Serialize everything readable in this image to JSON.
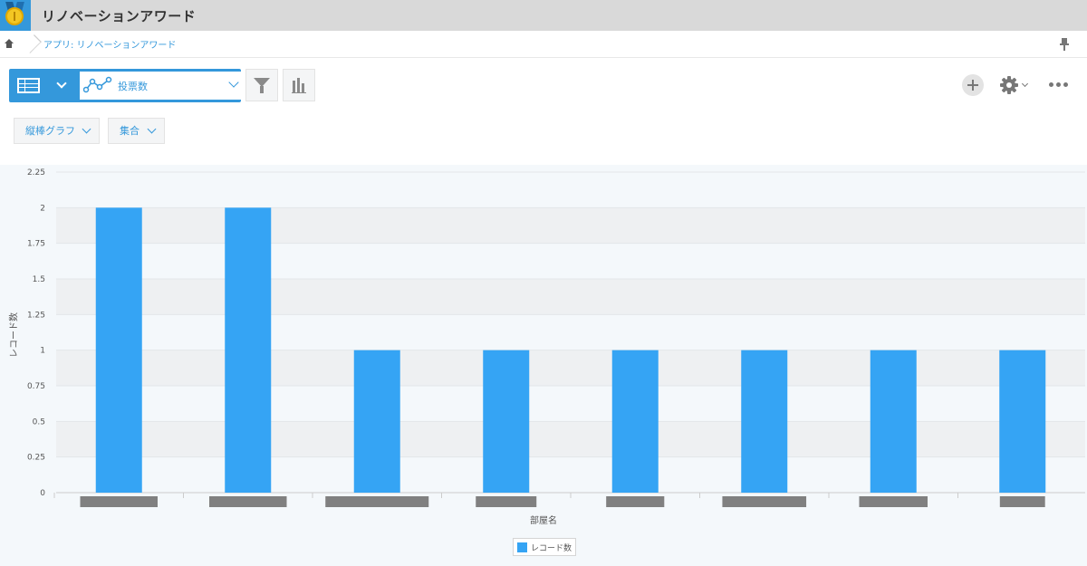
{
  "app": {
    "title": "リノベーションアワード"
  },
  "breadcrumb": {
    "text": "アプリ: リノベーションアワード"
  },
  "toolbar": {
    "graph_label": "投票数",
    "chart_type_label": "縦棒グラフ",
    "aggregation_label": "集合"
  },
  "colors": {
    "accent": "#3498db",
    "bar": "#35a4f4",
    "header_bg": "#d9d9d9"
  },
  "icons": [
    "home-icon",
    "pin-icon",
    "table-view-icon",
    "line-graph-icon",
    "filter-icon",
    "bar-chart-icon",
    "plus-icon",
    "gear-icon",
    "more-icon"
  ],
  "chart_data": {
    "type": "bar",
    "categories": [
      "",
      "",
      "",
      "",
      "",
      "",
      "",
      ""
    ],
    "series": [
      {
        "name": "レコード数",
        "values": [
          2,
          2,
          1,
          1,
          1,
          1,
          1,
          1
        ]
      }
    ],
    "ylim": [
      0,
      2.25
    ],
    "yticks": [
      "0",
      "0.25",
      "0.5",
      "0.75",
      "1",
      "1.25",
      "1.5",
      "1.75",
      "2",
      "2.25"
    ],
    "xlabel": "部屋名",
    "ylabel": "レコード数",
    "legend": "bottom-center",
    "grid": true
  }
}
